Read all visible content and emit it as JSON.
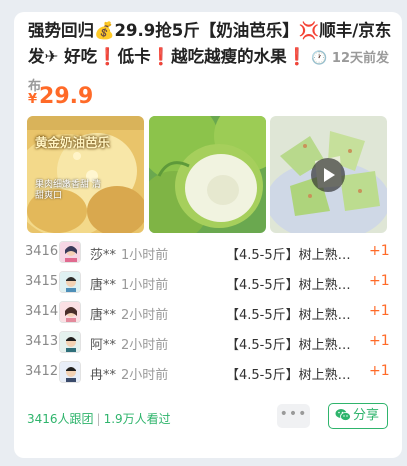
{
  "post": {
    "title": "强势回归💰29.9抢5斤【奶油芭乐】💢顺丰/京东发✈ 好吃❗低卡❗越吃越瘦的水果❗",
    "posted_ago": "🕐 12天前发布",
    "price_currency": "¥",
    "price_value": "29.9"
  },
  "media": {
    "photo1_overlay_title": "黄金奶油芭乐",
    "photo1_overlay_sub": "果肉细嫩香甜 清甜爽口"
  },
  "participants": [
    {
      "number": "3416",
      "name": "莎**",
      "time": "1小时前",
      "order": "【4.5-5斤】树上熟…",
      "qty": "+1"
    },
    {
      "number": "3415",
      "name": "唐**",
      "time": "1小时前",
      "order": "【4.5-5斤】树上熟…",
      "qty": "+1"
    },
    {
      "number": "3414",
      "name": "唐**",
      "time": "2小时前",
      "order": "【4.5-5斤】树上熟…",
      "qty": "+1"
    },
    {
      "number": "3413",
      "name": "阿**",
      "time": "2小时前",
      "order": "【4.5-5斤】树上熟…",
      "qty": "+1"
    },
    {
      "number": "3412",
      "name": "冉**",
      "time": "2小时前",
      "order": "【4.5-5斤】树上熟…",
      "qty": "+1"
    }
  ],
  "footer": {
    "group_count": "3416人跟团",
    "views": "1.9万人看过",
    "more_label": "•••",
    "share_label": "分享"
  },
  "colors": {
    "accent_orange": "#ff6a28",
    "accent_green": "#2fb46c"
  },
  "icons": [
    "money-bag-icon",
    "anger-icon",
    "airplane-icon",
    "exclamation-icon",
    "clock-icon",
    "play-icon",
    "more-icon",
    "wechat-icon"
  ]
}
